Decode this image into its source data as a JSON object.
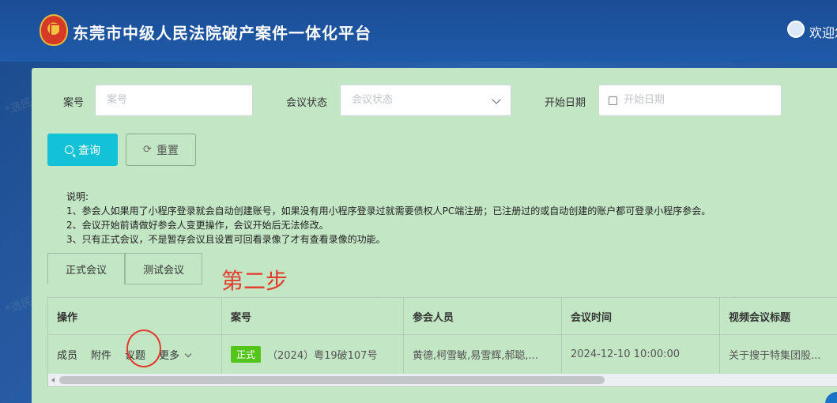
{
  "header": {
    "site_title": "东莞市中级人民法院破产案件一体化平台",
    "welcome_text": "欢迎您"
  },
  "watermark_text": "*选民",
  "filters": {
    "case_no": {
      "label": "案号",
      "placeholder": "案号"
    },
    "status": {
      "label": "会议状态",
      "placeholder": "会议状态"
    },
    "start_date": {
      "label": "开始日期",
      "placeholder": "开始日期"
    }
  },
  "buttons": {
    "query": "查询",
    "reset": "重置"
  },
  "notes": {
    "title": "说明:",
    "lines": [
      "1、参会人如果用了小程序登录就会自动创建账号，如果没有用小程序登录过就需要债权人PC端注册；已注册过的或自动创建的账户都可登录小程序参会。",
      "2、会议开始前请做好参会人变更操作，会议开始后无法修改。",
      "3、只有正式会议，不是暂存会议且设置可回看录像了才有查看录像的功能。"
    ]
  },
  "tabs": [
    {
      "label": "正式会议",
      "active": true
    },
    {
      "label": "测试会议",
      "active": false
    }
  ],
  "annotation": "第二步",
  "table": {
    "headers": [
      "操作",
      "案号",
      "参会人员",
      "会议时间",
      "视频会议标题"
    ],
    "row": {
      "actions": [
        "成员",
        "附件",
        "议题",
        "更多"
      ],
      "badge": "正式",
      "case_no": "（2024）粤19破107号",
      "attendees": "黄德,柯雪敏,易雪辉,郝聪,...",
      "time": "2024-12-10 10:00:00",
      "title": "关于搜于特集团股..."
    }
  },
  "colors": {
    "accent": "#13c2d6",
    "badge": "#52c41a",
    "annotation": "#e23b2e"
  }
}
